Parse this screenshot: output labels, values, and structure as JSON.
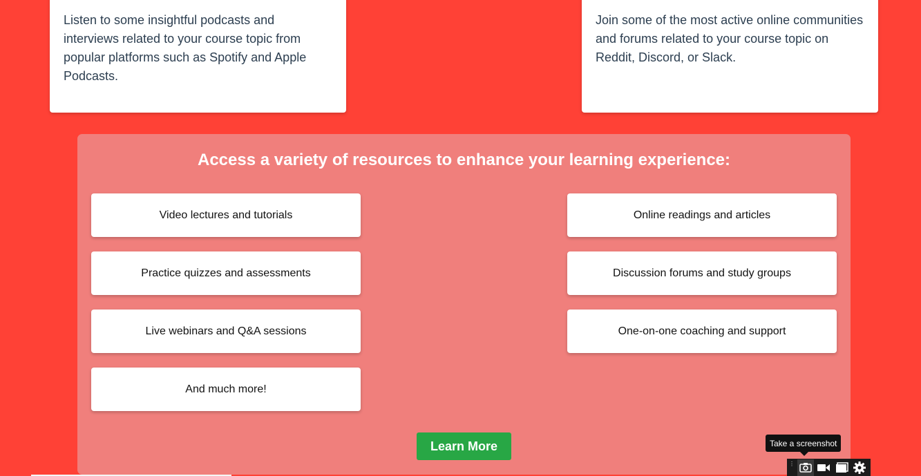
{
  "top_cards": {
    "left_text": "Listen to some insightful podcasts and interviews related to your course topic from popular platforms such as Spotify and Apple Podcasts.",
    "right_text": "Join some of the most active online communities and forums related to your course topic on Reddit, Discord, or Slack."
  },
  "resources": {
    "title": "Access a variety of resources to enhance your learning experience:",
    "items": [
      "Video lectures and tutorials",
      "Online readings and articles",
      "Practice quizzes and assessments",
      "Discussion forums and study groups",
      "Live webinars and Q&A sessions",
      "One-on-one coaching and support",
      "And much more!"
    ],
    "button_label": "Learn More"
  },
  "capture_toolbar": {
    "tooltip": "Take a screenshot",
    "icons": [
      "drag-grip-icon",
      "camera-icon",
      "video-camera-icon",
      "window-icon",
      "gear-icon"
    ]
  },
  "colors": {
    "page_background": "#ff4136",
    "panel_background": "#f07f7c",
    "button_green": "#28a745",
    "card_text": "#2c3e50"
  }
}
